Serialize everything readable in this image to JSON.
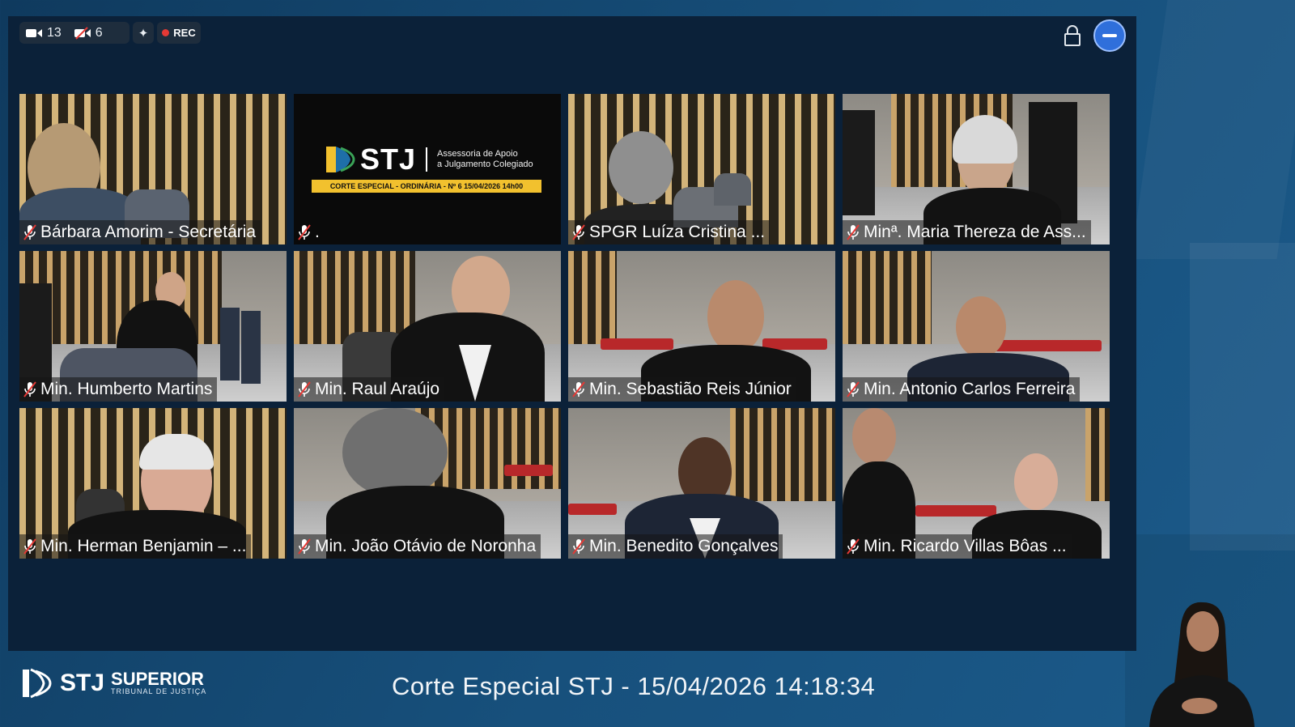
{
  "top_bar": {
    "video_count": "13",
    "video_off_count": "6",
    "rec_label": "REC"
  },
  "slide": {
    "logo_text": "STJ",
    "subtitle_line1": "Assessoria de Apoio",
    "subtitle_line2": "a Julgamento Colegiado",
    "banner": "CORTE ESPECIAL - ORDINÁRIA - Nº 6 15/04/2026 14h00"
  },
  "participants": [
    {
      "name": "Bárbara Amorim - Secretária"
    },
    {
      "name": "."
    },
    {
      "name": "SPGR Luíza Cristina ..."
    },
    {
      "name": "Minª. Maria Thereza de Ass..."
    },
    {
      "name": "Min. Humberto Martins"
    },
    {
      "name": "Min. Raul Araújo"
    },
    {
      "name": "Min. Sebastião Reis Júnior"
    },
    {
      "name": "Min. Antonio Carlos Ferreira"
    },
    {
      "name": "Min. Herman Benjamin – ..."
    },
    {
      "name": "Min. João Otávio de Noronha"
    },
    {
      "name": "Min. Benedito Gonçalves"
    },
    {
      "name": "Min. Ricardo Villas Bôas ..."
    }
  ],
  "footer": {
    "logo_stj": "STJ",
    "logo_superior": "SUPERIOR",
    "logo_tribunal": "TRIBUNAL DE JUSTIÇA",
    "title": "Corte Especial STJ - 15/04/2026 14:18:34"
  },
  "colors": {
    "accent": "#2f6fdb",
    "rec": "#e53935",
    "banner": "#f2c12e"
  },
  "icons": [
    "camera-icon",
    "video-off-icon",
    "sparkle-icon",
    "lock-icon",
    "leave-icon",
    "mic-muted-icon"
  ]
}
